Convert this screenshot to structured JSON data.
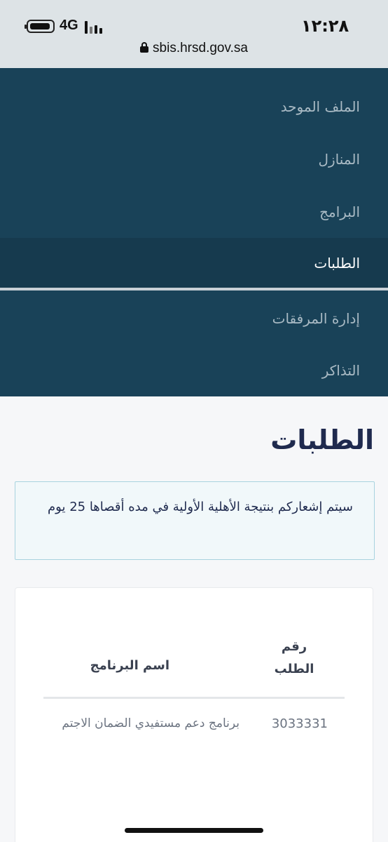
{
  "status_bar": {
    "time": "١٢:٢٨",
    "network": "4G",
    "battery_icon": "battery-icon",
    "signal_icon": "signal-bars-icon"
  },
  "browser": {
    "url": "sbis.hrsd.gov.sa",
    "lock_icon": "lock-icon"
  },
  "nav": {
    "items": [
      {
        "label": "الملف الموحد",
        "active": false
      },
      {
        "label": "المنازل",
        "active": false
      },
      {
        "label": "البرامج",
        "active": false
      },
      {
        "label": "الطلبات",
        "active": true
      },
      {
        "label": "إدارة المرفقات",
        "active": false
      },
      {
        "label": "التذاكر",
        "active": false
      }
    ]
  },
  "main": {
    "title": "الطلبات",
    "alert": "سيتم إشعاركم بنتيجة الأهلية الأولية في مده أقصاها 25 يوم",
    "table": {
      "headers": {
        "request_number": "رقم الطلب",
        "program_name": "اسم البرنامج"
      },
      "rows": [
        {
          "request_number": "3033331",
          "program_name": "برنامج دعم مستفيدي الضمان الاجتم"
        }
      ]
    }
  },
  "colors": {
    "nav_bg": "#194258",
    "nav_active_bg": "#163a4e",
    "title": "#1f2a4e",
    "alert_border": "#a8d3df"
  }
}
